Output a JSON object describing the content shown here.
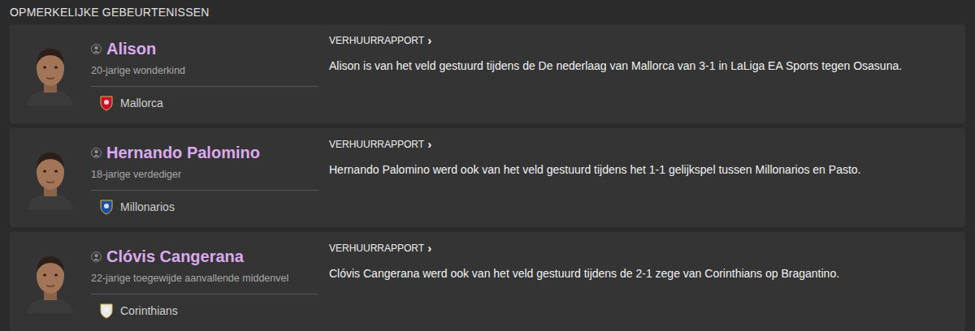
{
  "section": {
    "title": "OPMERKELIJKE GEBEURTENISSEN"
  },
  "events": [
    {
      "name": "Alison",
      "description": "20-jarige wonderkind",
      "club": {
        "name": "Mallorca",
        "color": "#c8102e"
      },
      "link": "VERHUURRAPPORT",
      "link_icon": "›",
      "text": "Alison is van het veld gestuurd tijdens de De nederlaag van Mallorca van 3-1 in LaLiga EA Sports tegen Osasuna."
    },
    {
      "name": "Hernando Palomino",
      "description": "18-jarige verdediger",
      "club": {
        "name": "Millonarios",
        "color": "#1d4fa0"
      },
      "link": "VERHUURRAPPORT",
      "link_icon": "›",
      "text": "Hernando Palomino werd ook van het veld gestuurd tijdens het 1-1 gelijkspel tussen Millonarios en Pasto."
    },
    {
      "name": "Clóvis Cangerana",
      "description": "22-jarige toegewijde aanvallende middenvel",
      "club": {
        "name": "Corinthians",
        "color": "#e8e8e8"
      },
      "link": "VERHUURRAPPORT",
      "link_icon": "›",
      "text": "Clóvis Cangerana werd ook van het veld gestuurd tijdens de 2-1 zege van Corinthians op Bragantino."
    }
  ]
}
